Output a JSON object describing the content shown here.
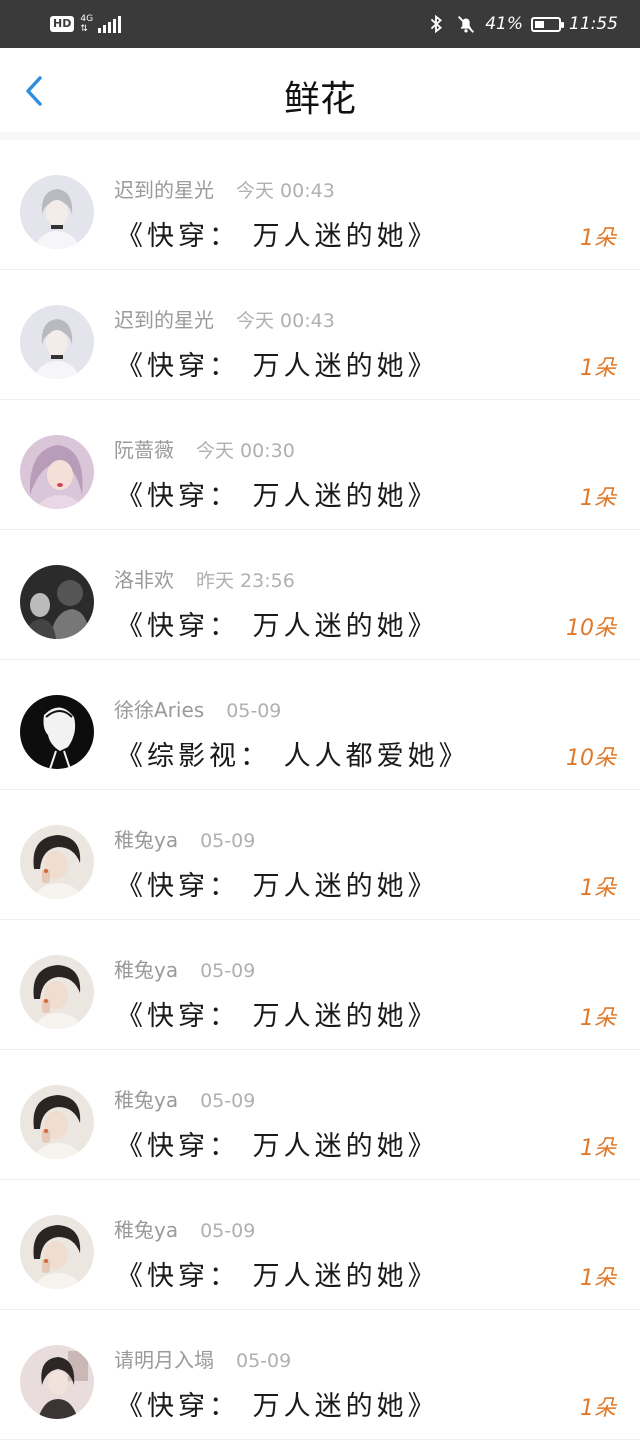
{
  "status_bar": {
    "hd": "HD",
    "network": "4G",
    "battery_percent": "41%",
    "battery_level": 0.41,
    "time": "11:55"
  },
  "header": {
    "title": "鲜花"
  },
  "colors": {
    "accent": "#2f8fdc",
    "flower_count": "#e07a2a"
  },
  "items": [
    {
      "user": "迟到的星光",
      "time": "今天 00:43",
      "book": "《快穿： 万人迷的她》",
      "count": "1朵",
      "avatar": "avatar-boy-1"
    },
    {
      "user": "迟到的星光",
      "time": "今天 00:43",
      "book": "《快穿： 万人迷的她》",
      "count": "1朵",
      "avatar": "avatar-boy-1"
    },
    {
      "user": "阮蔷薇",
      "time": "今天 00:30",
      "book": "《快穿： 万人迷的她》",
      "count": "1朵",
      "avatar": "avatar-girl-pink"
    },
    {
      "user": "洛非欢",
      "time": "昨天 23:56",
      "book": "《快穿： 万人迷的她》",
      "count": "10朵",
      "avatar": "avatar-dark-photo"
    },
    {
      "user": "徐徐Aries",
      "time": "05-09",
      "book": "《综影视： 人人都爱她》",
      "count": "10朵",
      "avatar": "avatar-black-sketch"
    },
    {
      "user": "稚兔ya",
      "time": "05-09",
      "book": "《快穿： 万人迷的她》",
      "count": "1朵",
      "avatar": "avatar-girl-photo"
    },
    {
      "user": "稚兔ya",
      "time": "05-09",
      "book": "《快穿： 万人迷的她》",
      "count": "1朵",
      "avatar": "avatar-girl-photo"
    },
    {
      "user": "稚兔ya",
      "time": "05-09",
      "book": "《快穿： 万人迷的她》",
      "count": "1朵",
      "avatar": "avatar-girl-photo"
    },
    {
      "user": "稚兔ya",
      "time": "05-09",
      "book": "《快穿： 万人迷的她》",
      "count": "1朵",
      "avatar": "avatar-girl-photo"
    },
    {
      "user": "请明月入塌",
      "time": "05-09",
      "book": "《快穿： 万人迷的她》",
      "count": "1朵",
      "avatar": "avatar-girl-room"
    }
  ]
}
